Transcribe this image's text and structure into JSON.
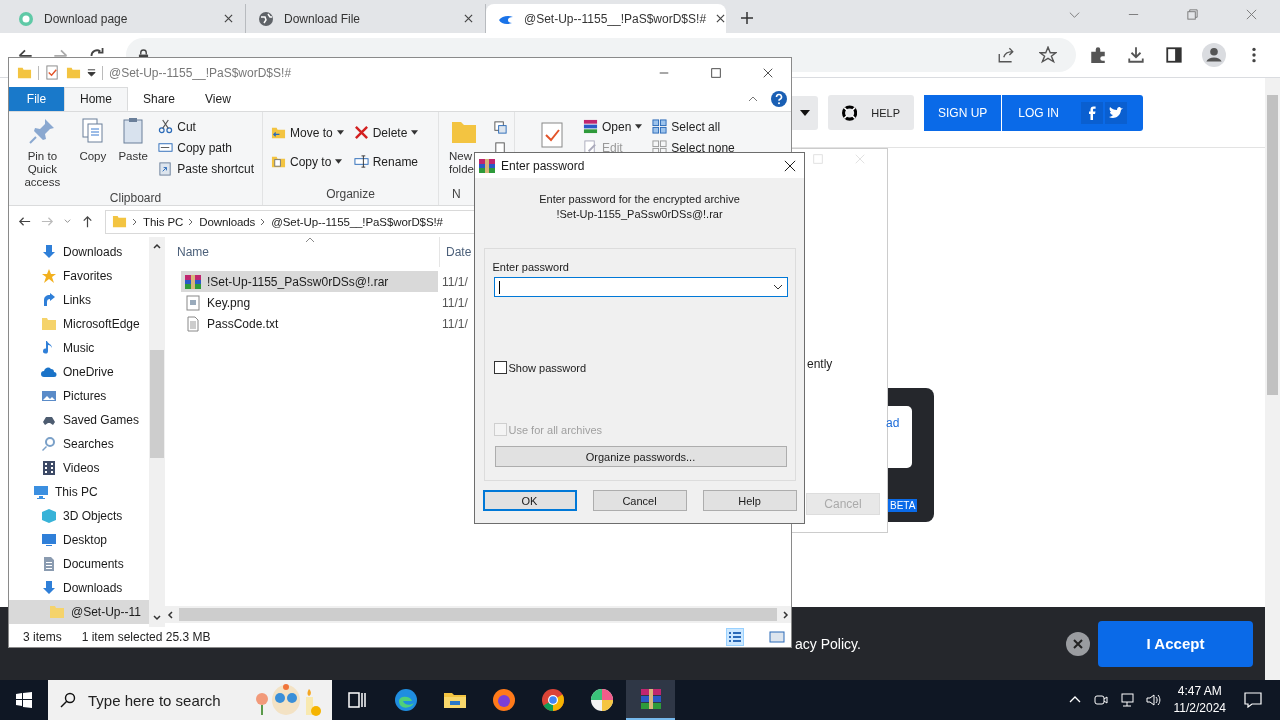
{
  "browser": {
    "tabs": [
      {
        "title": "Download page",
        "kind": "ring",
        "selected": false
      },
      {
        "title": "Download File",
        "kind": "globe",
        "selected": false
      },
      {
        "title": "@Set-Up--1155__!PaS$worD$S!#",
        "kind": "flame",
        "selected": true
      }
    ],
    "page": {
      "help_button": "HELP",
      "sign_up_button": "SIGN UP",
      "log_in_button": "LOG IN",
      "body_text": "ently",
      "link_text": "ad",
      "cancel_button": "Cancel",
      "badge": "BETA",
      "cookie_text": "acy Policy.",
      "accept_button": "I Accept"
    }
  },
  "explorer": {
    "title": "@Set-Up--1155__!PaS$worD$S!#",
    "ribbon_tabs": [
      {
        "label": "File",
        "kind": "file",
        "selected": false
      },
      {
        "label": "Home",
        "kind": "tab",
        "selected": true
      },
      {
        "label": "Share",
        "kind": "tab",
        "selected": false
      },
      {
        "label": "View",
        "kind": "tab",
        "selected": false
      }
    ],
    "clipboard": {
      "label": "Clipboard",
      "pin": "Pin to Quick access",
      "copy": "Copy",
      "paste": "Paste",
      "cut": "Cut",
      "copy_path": "Copy path",
      "paste_shortcut": "Paste shortcut"
    },
    "organize": {
      "label": "Organize",
      "move_to": "Move to",
      "copy_to": "Copy to",
      "delete": "Delete",
      "rename": "Rename"
    },
    "new": {
      "label": "N",
      "new_folder": "New folde"
    },
    "open": {
      "open": "Open",
      "edit": "Edit"
    },
    "select": {
      "select_all": "Select all",
      "select_none": "Select none"
    },
    "address": [
      "This PC",
      "Downloads",
      "@Set-Up--1155__!PaS$worD$S!#"
    ],
    "nav_pane": {
      "items": [
        {
          "label": "Downloads",
          "kind": "download",
          "selected": false
        },
        {
          "label": "Favorites",
          "kind": "star",
          "selected": false
        },
        {
          "label": "Links",
          "kind": "link",
          "selected": false
        },
        {
          "label": "MicrosoftEdge",
          "kind": "folder",
          "selected": false
        },
        {
          "label": "Music",
          "kind": "music",
          "selected": false
        },
        {
          "label": "OneDrive",
          "kind": "cloud",
          "selected": false
        },
        {
          "label": "Pictures",
          "kind": "pictures",
          "selected": false
        },
        {
          "label": "Saved Games",
          "kind": "games",
          "selected": false
        },
        {
          "label": "Searches",
          "kind": "search",
          "selected": false
        },
        {
          "label": "Videos",
          "kind": "video",
          "selected": false
        },
        {
          "label": "This PC",
          "kind": "pc",
          "selected": false,
          "children": [
            {
              "label": "3D Objects",
              "kind": "cube",
              "selected": false
            },
            {
              "label": "Desktop",
              "kind": "desktop",
              "selected": false
            },
            {
              "label": "Documents",
              "kind": "document",
              "selected": false
            },
            {
              "label": "Downloads",
              "kind": "download",
              "selected": false,
              "children": [
                {
                  "label": "@Set-Up--11",
                  "kind": "folder",
                  "selected": true
                }
              ]
            }
          ]
        }
      ]
    },
    "columns": [
      "Name",
      "Date"
    ],
    "files": [
      {
        "name": "!Set-Up-1155_PaSsw0rDSs@!.rar",
        "date": "11/1/",
        "kind": "archive",
        "selected": true
      },
      {
        "name": "Key.png",
        "date": "11/1/",
        "kind": "image",
        "selected": false
      },
      {
        "name": "PassCode.txt",
        "date": "11/1/",
        "kind": "text",
        "selected": false
      }
    ],
    "status": {
      "count": "3 items",
      "selection": "1 item selected  25.3 MB"
    }
  },
  "dialog": {
    "title": "Enter password",
    "message": "Enter password for the encrypted archive",
    "archive": "!Set-Up-1155_PaSsw0rDSs@!.rar",
    "field_label": "Enter password",
    "checkboxes": [
      {
        "label": "Show password",
        "checked": false,
        "disabled": false
      },
      {
        "label": "Use for all archives",
        "checked": false,
        "disabled": true
      }
    ],
    "organize_button": "Organize passwords...",
    "buttons": [
      {
        "label": "OK",
        "default": true
      },
      {
        "label": "Cancel",
        "default": false
      },
      {
        "label": "Help",
        "default": false
      }
    ]
  },
  "taskbar": {
    "search_placeholder": "Type here to search",
    "apps": [
      {
        "kind": "taskview",
        "active": false
      },
      {
        "kind": "edge",
        "active": false
      },
      {
        "kind": "explorer",
        "active": false
      },
      {
        "kind": "firefox",
        "active": false
      },
      {
        "kind": "chrome",
        "active": false
      },
      {
        "kind": "paint",
        "active": false
      },
      {
        "kind": "winrar",
        "active": true
      }
    ],
    "time": "4:47 AM",
    "date": "11/2/2024"
  }
}
